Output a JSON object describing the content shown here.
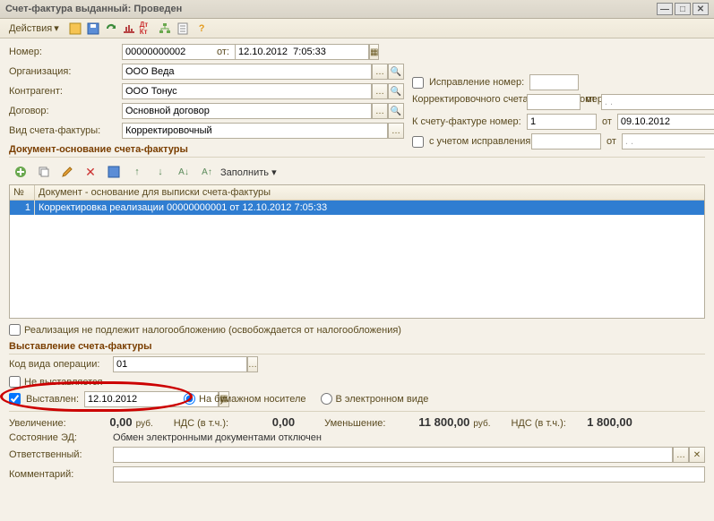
{
  "window_title": "Счет-фактура выданный: Проведен",
  "toolbar": {
    "actions": "Действия",
    "fill": "Заполнить"
  },
  "labels": {
    "number": "Номер:",
    "date_from": "от:",
    "org": "Организация:",
    "contragent": "Контрагент:",
    "contract": "Договор:",
    "sf_type": "Вид счета-фактуры:",
    "corr_num": "Исправление номер:",
    "corr_sf": "Корректировочного счета-фактуры номер:",
    "to_sf": "К счету-фактуре номер:",
    "with_corr": "с учетом исправления:",
    "ot": "от",
    "docs_section": "Документ-основание счета-фактуры",
    "issue_section": "Выставление счета-фактуры",
    "op_code": "Код вида операции:",
    "not_issued": "Не выставляется",
    "issued": "Выставлен:",
    "paper": "На бумажном носителе",
    "electronic": "В электронном виде",
    "no_tax": "Реализация не подлежит налогообложению (освобождается от налогообложения)",
    "increase": "Увеличение:",
    "nds": "НДС (в т.ч.):",
    "decrease": "Уменьшение:",
    "ed_state": "Состояние ЭД:",
    "responsible": "Ответственный:",
    "comment": "Комментарий:",
    "rub": "руб."
  },
  "values": {
    "number": "00000000002",
    "datetime": "12.10.2012  7:05:33",
    "org": "ООО Веда",
    "contragent": "ООО Тонус",
    "contract": "Основной договор",
    "sf_type": "Корректировочный",
    "to_sf_num": "1",
    "to_sf_date": "09.10.2012",
    "corr_sf_num": "",
    "corr_sf_date": ". .",
    "with_corr_num": "",
    "with_corr_date": ". .",
    "op_code": "01",
    "issued_date": "12.10.2012",
    "inc_sum": "0,00",
    "inc_nds": "0,00",
    "dec_sum": "11 800,00",
    "dec_nds": "1 800,00",
    "ed_state": "Обмен электронными документами отключен",
    "responsible": "",
    "comment": ""
  },
  "grid": {
    "col_num": "№",
    "col_doc": "Документ - основание для выписки счета-фактуры",
    "rows": [
      {
        "n": "1",
        "doc": "Корректировка реализации 00000000001 от 12.10.2012 7:05:33"
      }
    ]
  },
  "icons": {
    "dropdown": "▾",
    "calendar": "▦",
    "dots": "…",
    "magnify": "🔍",
    "clear": "✕",
    "min": "—",
    "max": "□",
    "close": "✕",
    "help": "?"
  }
}
